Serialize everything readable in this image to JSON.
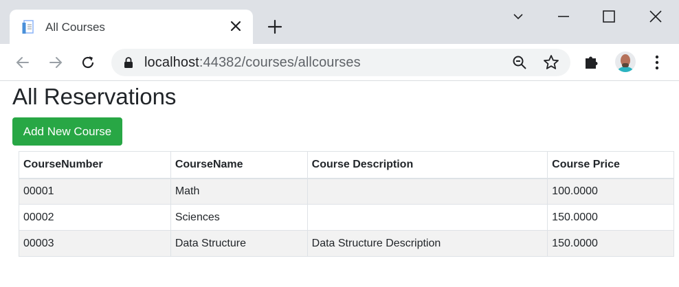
{
  "browser": {
    "tab_title": "All Courses",
    "url_host": "localhost",
    "url_rest": ":44382/courses/allcourses"
  },
  "page": {
    "title": "All Reservations",
    "add_button_label": "Add New Course"
  },
  "table": {
    "headers": [
      "CourseNumber",
      "CourseName",
      "Course Description",
      "Course Price"
    ],
    "rows": [
      [
        "00001",
        "Math",
        "",
        "100.0000"
      ],
      [
        "00002",
        "Sciences",
        "",
        "150.0000"
      ],
      [
        "00003",
        "Data Structure",
        "Data Structure Description",
        "150.0000"
      ]
    ]
  },
  "colors": {
    "accent_green": "#28a745",
    "tabstrip_bg": "#dee1e6",
    "omnibox_bg": "#f1f3f4"
  },
  "icons": [
    "page-favicon-icon",
    "close-icon",
    "plus-icon",
    "chevron-down-icon",
    "minimize-icon",
    "maximize-icon",
    "close-window-icon",
    "back-arrow-icon",
    "forward-arrow-icon",
    "reload-icon",
    "lock-icon",
    "zoom-out-icon",
    "star-icon",
    "extensions-puzzle-icon",
    "kebab-menu-icon"
  ]
}
